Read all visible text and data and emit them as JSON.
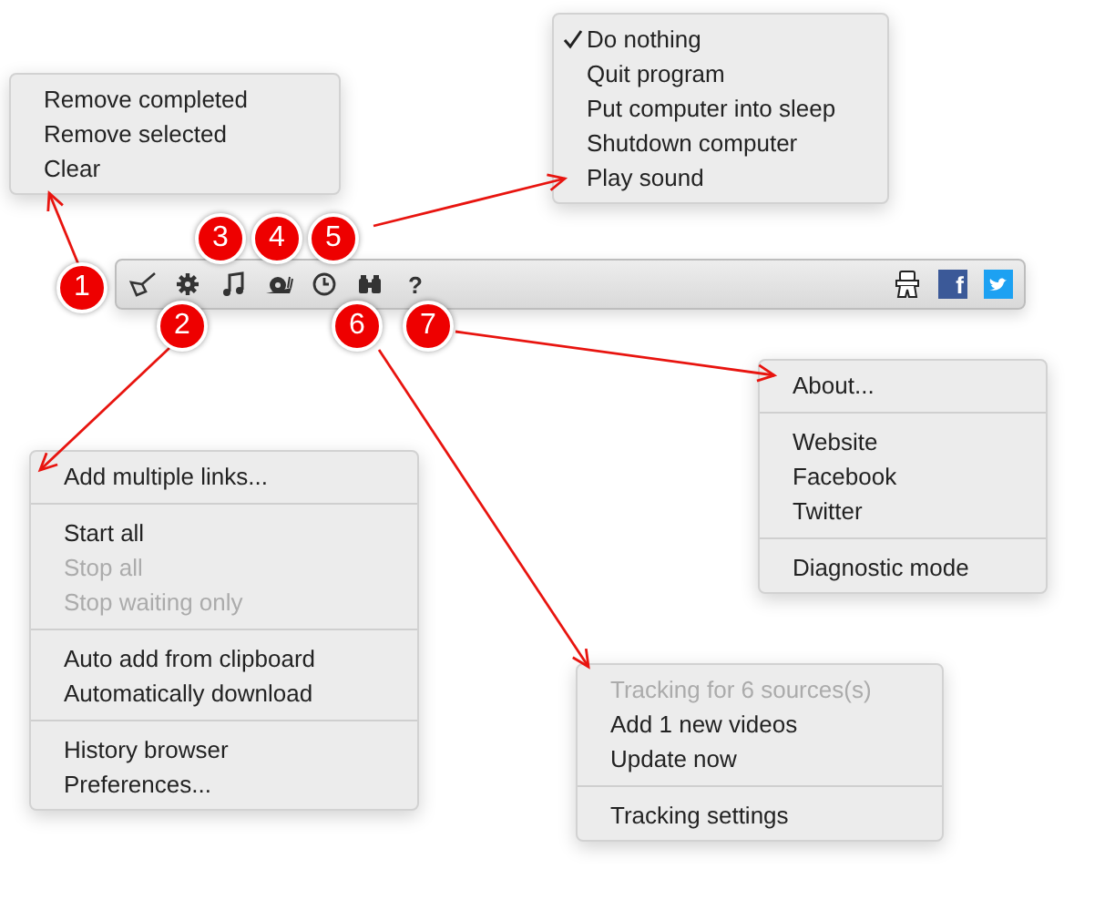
{
  "menus": [
    {
      "items": [
        {
          "kind": "item",
          "label": "Remove completed",
          "disabled": false
        },
        {
          "kind": "item",
          "label": "Remove selected",
          "disabled": false
        },
        {
          "kind": "item",
          "label": "Clear",
          "disabled": false
        }
      ]
    },
    {
      "items": [
        {
          "kind": "item",
          "label": "Do nothing",
          "disabled": false,
          "checked": true
        },
        {
          "kind": "item",
          "label": "Quit program",
          "disabled": false,
          "checked": false
        },
        {
          "kind": "item",
          "label": "Put computer into sleep",
          "disabled": false,
          "checked": false
        },
        {
          "kind": "item",
          "label": "Shutdown computer",
          "disabled": false,
          "checked": false
        },
        {
          "kind": "item",
          "label": "Play sound",
          "disabled": false,
          "checked": false
        }
      ]
    },
    {
      "items": [
        {
          "kind": "item",
          "label": "About...",
          "disabled": false
        },
        {
          "kind": "separator"
        },
        {
          "kind": "item",
          "label": "Website",
          "disabled": false
        },
        {
          "kind": "item",
          "label": "Facebook",
          "disabled": false
        },
        {
          "kind": "item",
          "label": "Twitter",
          "disabled": false
        },
        {
          "kind": "separator"
        },
        {
          "kind": "item",
          "label": "Diagnostic mode",
          "disabled": false
        }
      ]
    },
    {
      "items": [
        {
          "kind": "item",
          "label": "Add multiple links...",
          "disabled": false
        },
        {
          "kind": "separator"
        },
        {
          "kind": "item",
          "label": "Start all",
          "disabled": false
        },
        {
          "kind": "item",
          "label": "Stop all",
          "disabled": true
        },
        {
          "kind": "item",
          "label": "Stop waiting only",
          "disabled": true
        },
        {
          "kind": "separator"
        },
        {
          "kind": "item",
          "label": "Auto add from clipboard",
          "disabled": false
        },
        {
          "kind": "item",
          "label": "Automatically download",
          "disabled": false
        },
        {
          "kind": "separator"
        },
        {
          "kind": "item",
          "label": "History browser",
          "disabled": false
        },
        {
          "kind": "item",
          "label": "Preferences...",
          "disabled": false
        }
      ]
    },
    {
      "items": [
        {
          "kind": "item",
          "label": "Tracking for 6 sources(s)",
          "disabled": true
        },
        {
          "kind": "item",
          "label": "Add 1 new videos",
          "disabled": false
        },
        {
          "kind": "item",
          "label": "Update now",
          "disabled": false
        },
        {
          "kind": "separator"
        },
        {
          "kind": "item",
          "label": "Tracking settings",
          "disabled": false
        }
      ]
    }
  ],
  "toolbar": {
    "help_glyph": "?",
    "facebook_glyph": "f"
  },
  "callouts": [
    "1",
    "2",
    "3",
    "4",
    "5",
    "6",
    "7"
  ]
}
